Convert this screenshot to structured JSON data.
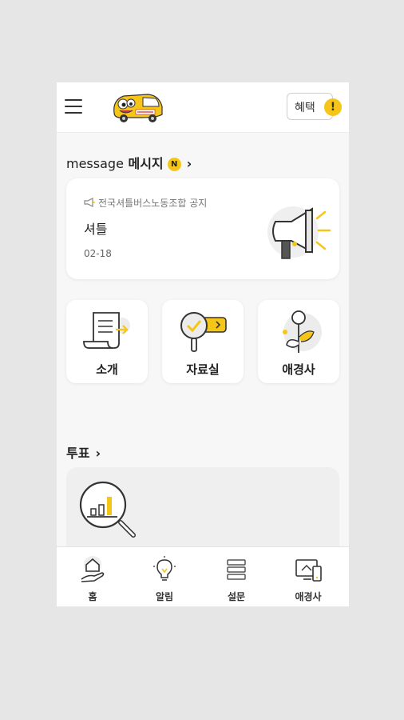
{
  "header": {
    "menu_icon": "hamburger-menu-icon",
    "logo_icon": "bus-mascot-logo",
    "benefit_label": "혜택",
    "benefit_badge": "!"
  },
  "message_section": {
    "title_latin": "message",
    "title_korean": "메시지",
    "new_badge": "N",
    "notice": {
      "source": "전국셔틀버스노동조합 공지",
      "title": "셔틀",
      "date": "02-18"
    }
  },
  "tiles": [
    {
      "label": "소개",
      "icon": "document-list-icon"
    },
    {
      "label": "자료실",
      "icon": "magnifier-check-icon"
    },
    {
      "label": "애경사",
      "icon": "flower-icon"
    }
  ],
  "vote_section": {
    "title": "투표",
    "icon": "search-chart-icon"
  },
  "bottom_nav": [
    {
      "label": "홈",
      "icon": "home-hand-icon"
    },
    {
      "label": "알림",
      "icon": "lightbulb-icon"
    },
    {
      "label": "설문",
      "icon": "survey-stack-icon"
    },
    {
      "label": "애경사",
      "icon": "monitor-device-icon"
    }
  ],
  "colors": {
    "accent": "#f5c518",
    "background": "#f7f7f7",
    "card": "#ffffff"
  }
}
